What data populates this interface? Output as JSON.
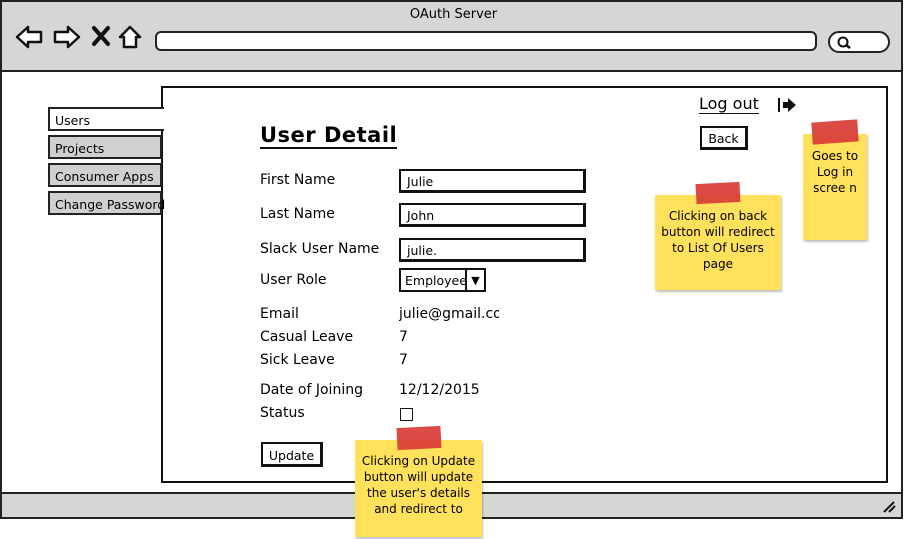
{
  "window": {
    "title": "OAuth Server"
  },
  "tabs": [
    {
      "label": "Users",
      "active": true
    },
    {
      "label": "Projects",
      "active": false
    },
    {
      "label": "Consumer Apps",
      "active": false
    },
    {
      "label": "Change Password",
      "active": false
    }
  ],
  "header": {
    "logout_label": "Log out",
    "back_label": "Back"
  },
  "form": {
    "title": "User Detail",
    "first_name_label": "First Name",
    "first_name_value": "Julie",
    "last_name_label": "Last Name",
    "last_name_value": "John",
    "slack_label": "Slack User Name",
    "slack_value": "julie.",
    "role_label": "User Role",
    "role_value": "Employee",
    "email_label": "Email",
    "email_value": "julie@gmail.com",
    "casual_leave_label": "Casual Leave",
    "casual_leave_value": "7",
    "sick_leave_label": "Sick Leave",
    "sick_leave_value": "7",
    "doj_label": "Date of Joining",
    "doj_value": "12/12/2015",
    "status_label": "Status",
    "status_checked": false,
    "update_label": "Update"
  },
  "notes": {
    "back_note": "Clicking on back button will redirect to List Of Users page",
    "logout_note": "Goes to Log in scree n",
    "update_note": "Clicking on Update button will update the user's details and redirect to"
  },
  "colors": {
    "chrome": "#d6d6d6",
    "sticky_note": "#ffe15b",
    "tape": "#d93b36"
  }
}
